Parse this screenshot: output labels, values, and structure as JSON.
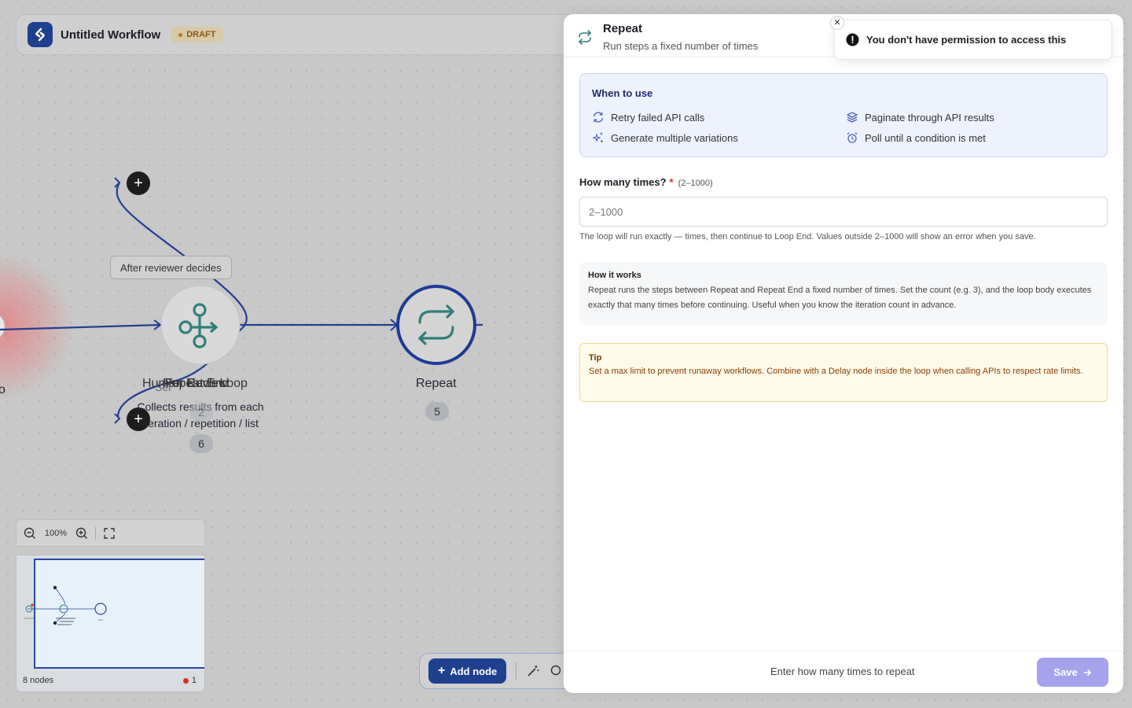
{
  "header": {
    "workflow_title": "Untitled Workflow",
    "status_badge": "DRAFT"
  },
  "canvas": {
    "edge_label": "After reviewer decides",
    "left_node_label_fragment": "o",
    "overlap_node_labels": [
      "Repeat End",
      "For Each Loop",
      "Human Review"
    ],
    "overlap_node_sub_fragment": "Sel",
    "overlap_node_description": "Collects results from each",
    "overlap_node_description_line2": "iteration / repetition / list",
    "overlap_node_badges": [
      "2",
      "6"
    ],
    "repeat_node": {
      "label": "Repeat",
      "badge": "5"
    }
  },
  "zoom": {
    "level": "100%"
  },
  "minimap": {
    "node_count": "8 nodes",
    "error_count": "1"
  },
  "toolbar": {
    "add_node_label": "Add node"
  },
  "panel": {
    "title": "Repeat",
    "subtitle": "Run steps a fixed number of times",
    "when_to_use": {
      "title": "When to use",
      "items": [
        {
          "label": "Retry failed API calls",
          "icon": "refresh-icon"
        },
        {
          "label": "Paginate through API results",
          "icon": "layers-icon"
        },
        {
          "label": "Generate multiple variations",
          "icon": "sparkles-icon"
        },
        {
          "label": "Poll until a condition is met",
          "icon": "alarm-clock-icon"
        }
      ]
    },
    "field": {
      "label": "How many times?",
      "required_mark": "*",
      "range_hint": "(2–1000)",
      "placeholder": "2–1000",
      "value": "",
      "help": "The loop will run exactly — times, then continue to Loop End. Values outside 2–1000 will show an error when you save."
    },
    "how_it_works": {
      "title": "How it works",
      "body": "Repeat runs the steps between Repeat and Repeat End a fixed number of times. Set the count (e.g. 3), and the loop body executes exactly that many times before continuing. Useful when you know the iteration count in advance."
    },
    "tip": {
      "title": "Tip",
      "body": "Set a max limit to prevent runaway workflows. Combine with a Delay node inside the loop when calling APIs to respect rate limits."
    },
    "footer": {
      "hint": "Enter how many times to repeat",
      "save_label": "Save"
    }
  },
  "toast": {
    "message": "You don't have permission to access this"
  },
  "colors": {
    "accent": "#1f3f8f",
    "node_teal": "#2f7f7a",
    "save_disabled": "#a6a2ec",
    "error": "#d92d20"
  }
}
